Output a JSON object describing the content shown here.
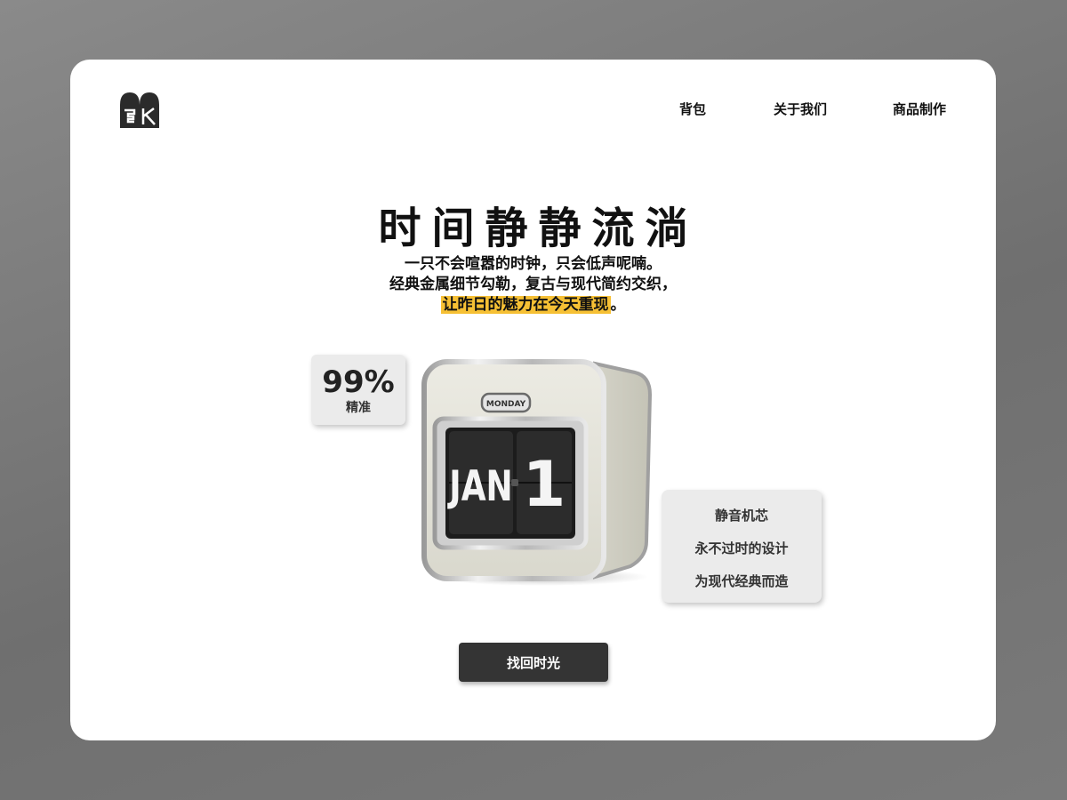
{
  "logo": {
    "icon": "ek-logo-icon"
  },
  "nav": {
    "items": [
      {
        "label": "背包"
      },
      {
        "label": "关于我们"
      },
      {
        "label": "商品制作"
      }
    ]
  },
  "hero": {
    "title": "时间静静流淌",
    "subtitle_line1": "一只不会喧嚣的时钟，只会低声呢喃。",
    "subtitle_line2": "经典金属细节勾勒，复古与现代简约交织，",
    "subtitle_line3_highlight": "让昨日的魅力在今天重现",
    "subtitle_line3_end": "。",
    "highlight_color": "#f6c034"
  },
  "badge": {
    "value": "99%",
    "label": "精准"
  },
  "clock": {
    "day": "MONDAY",
    "month": "JAN",
    "date": "1"
  },
  "features": {
    "items": [
      "静音机芯",
      "永不过时的设计",
      "为现代经典而造"
    ]
  },
  "cta": {
    "label": "找回时光"
  }
}
